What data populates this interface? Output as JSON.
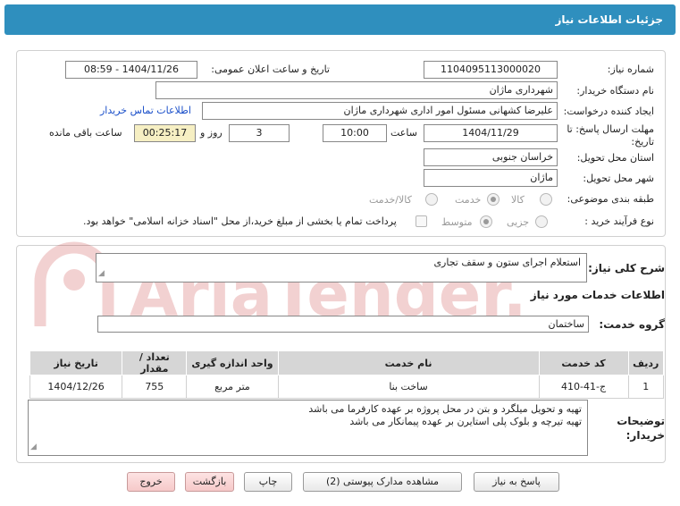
{
  "header": {
    "title": "جزئیات اطلاعات نیاز"
  },
  "form": {
    "need_number": {
      "label": "شماره نیاز:",
      "value": "1104095113000020"
    },
    "announce_datetime": {
      "label": "تاریخ و ساعت اعلان عمومی:",
      "value": "1404/11/26 - 08:59"
    },
    "buyer_org": {
      "label": "نام دستگاه خریدار:",
      "value": "شهرداری ماژان"
    },
    "requester": {
      "label": "ایجاد کننده درخواست:",
      "value": "علیرضا کشهانی مسئول امور اداری شهرداری ماژان",
      "contact_link": "اطلاعات تماس خریدار"
    },
    "deadline": {
      "label": "مهلت ارسال پاسخ: تا تاریخ:",
      "date": "1404/11/29",
      "time_label": "ساعت",
      "time": "10:00",
      "days": "3",
      "days_label": "روز و",
      "remaining": "00:25:17",
      "remaining_label": "ساعت باقی مانده"
    },
    "province": {
      "label": "استان محل تحویل:",
      "value": "خراسان جنوبی"
    },
    "city": {
      "label": "شهر محل تحویل:",
      "value": "ماژان"
    },
    "category": {
      "label": "طبقه بندی موضوعی:",
      "options": [
        "کالا",
        "خدمت",
        "کالا/خدمت"
      ],
      "selected": "خدمت"
    },
    "process": {
      "label": "نوع فرآیند خرید :",
      "options": [
        "جزیی",
        "متوسط"
      ],
      "selected": "متوسط",
      "payment_note": "پرداخت تمام یا بخشی از مبلغ خرید،از محل \"اسناد خزانه اسلامی\" خواهد بود."
    }
  },
  "description": {
    "label": "شرح کلی نیاز:",
    "value": "استعلام اجرای ستون و سقف تجاری"
  },
  "services_title": "اطلاعات خدمات مورد نیاز",
  "service_group": {
    "label": "گروه خدمت:",
    "value": "ساختمان"
  },
  "table": {
    "headers": [
      "ردیف",
      "کد خدمت",
      "نام خدمت",
      "واحد اندازه گیری",
      "تعداد / مقدار",
      "تاریخ نیاز"
    ],
    "rows": [
      [
        "1",
        "ج-41-410",
        "ساخت بنا",
        "متر مربع",
        "755",
        "1404/12/26"
      ]
    ]
  },
  "buyer_notes": {
    "label_line1": "توضیحات",
    "label_line2": "خریدار:",
    "line1": "تهیه و تحویل میلگرد و بتن در محل پروژه بر عهده کارفرما می باشد",
    "line2": "تهیه تیرچه و بلوک پلی استایرن بر عهده پیمانکار می باشد"
  },
  "buttons": {
    "reply": "پاسخ به نیاز",
    "attachments": "مشاهده مدارک پیوستی (2)",
    "print": "چاپ",
    "back": "بازگشت",
    "exit": "خروج"
  },
  "watermark": {
    "text": "AriaTender.neT"
  },
  "colors": {
    "header": "#2f8fbe",
    "link": "#1a4fc9",
    "remaining_bg": "#f6efc3",
    "watermark": "#c83232"
  }
}
